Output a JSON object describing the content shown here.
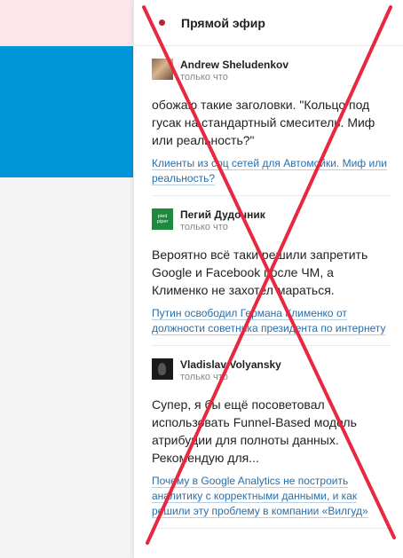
{
  "panel": {
    "title": "Прямой эфир",
    "items": [
      {
        "author": "Andrew Sheludenkov",
        "time": "только что",
        "comment": "обожаю такие заголовки. \"Кольцо под гусак на стандартный смеситель. Миф или реальность?\"",
        "article": "Клиенты из соц сетей для Автомойки. Миф или реальность?",
        "avatar": "user-photo-icon"
      },
      {
        "author": "Пегий Дудочник",
        "time": "только что",
        "comment": "Вероятно всё таки решили запретить Google и Facebook после ЧМ, а Клименко не захотел мараться.",
        "article": "Путин освободил Германа Клименко от должности советника президента по интернету",
        "avatar": "green-logo-icon",
        "avatar_text": "pied piper"
      },
      {
        "author": "Vladislav Volyansky",
        "time": "только что",
        "comment": "Супер, я бы ещё посоветовал использовать Funnel-Based модель атрибуции для полноты данных. Рекомендую для...",
        "article": "Почему в Google Analytics не построить аналитику с корректными данными, и как решили эту проблему в компании «Вилгуд»",
        "avatar": "user-photo-icon"
      }
    ]
  },
  "colors": {
    "cross": "#e8283f",
    "live_dot": "#c0202f",
    "link": "#2a6ea8",
    "left_blue": "#0096d9",
    "left_pink": "#fde7ec"
  }
}
